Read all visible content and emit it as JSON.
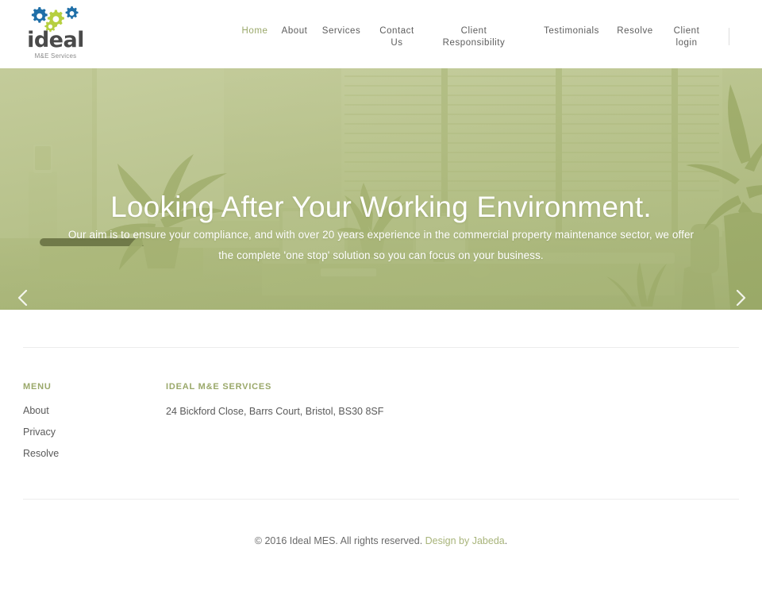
{
  "site": {
    "brand": {
      "word": "ideal",
      "tagline": "M&E Services",
      "icon": "gears-logo-icon"
    }
  },
  "header": {
    "nav": [
      {
        "label": "Home",
        "active": true
      },
      {
        "label": "About",
        "active": false
      },
      {
        "label": "Services",
        "active": false
      },
      {
        "label": "Contact\nUs",
        "active": false
      },
      {
        "label": "Client\nResponsibility",
        "active": false
      },
      {
        "label": "Testimonials",
        "active": false
      },
      {
        "label": "Resolve",
        "active": false
      },
      {
        "label": "Client\nlogin",
        "active": false
      }
    ]
  },
  "hero": {
    "title": "Looking After Your Working Environment.",
    "subtitle": "Our aim is to ensure your compliance, and with over 20 years experience in the commercial property maintenance sector, we offer the complete 'one stop' solution so you can focus on your business.",
    "prev_icon": "chevron-left-icon",
    "next_icon": "chevron-right-icon",
    "slide_count": 3,
    "active_slide": 1,
    "overlay_color": "#a7b46a",
    "background_description": "office interior with desks, monitors, window blinds and potted plants"
  },
  "footer": {
    "menu": {
      "heading": "MENU",
      "links": [
        "About",
        "Privacy",
        "Resolve"
      ]
    },
    "company": {
      "heading": "IDEAL M&E SERVICES",
      "address": "24 Bickford Close, Barrs Court, Bristol, BS30 8SF"
    },
    "copyright": {
      "text": "© 2016 Ideal MES. All rights reserved. ",
      "link_label": "Design by Jabeda",
      "suffix": "."
    },
    "accent_color": "#9aa86a"
  }
}
